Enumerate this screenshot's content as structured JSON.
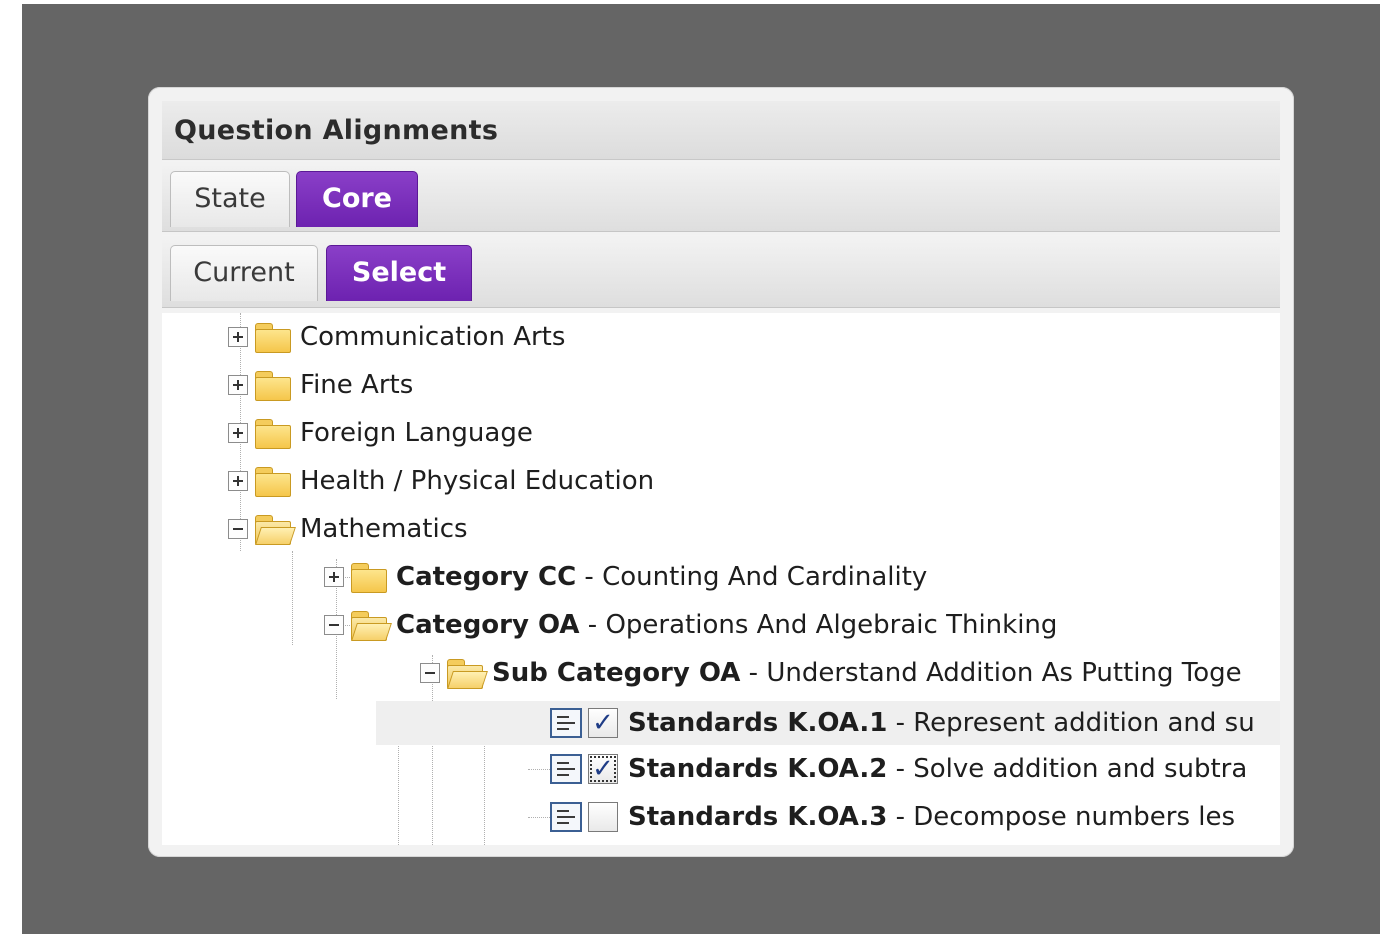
{
  "panel": {
    "title": "Question Alignments"
  },
  "tabs_primary": [
    {
      "label": "State",
      "active": false
    },
    {
      "label": "Core",
      "active": true
    }
  ],
  "tabs_secondary": [
    {
      "label": "Current",
      "active": false
    },
    {
      "label": "Select",
      "active": true
    }
  ],
  "tree": {
    "subjects": [
      {
        "label": "Communication Arts",
        "expanded": false
      },
      {
        "label": "Fine Arts",
        "expanded": false
      },
      {
        "label": "Foreign Language",
        "expanded": false
      },
      {
        "label": "Health / Physical Education",
        "expanded": false
      },
      {
        "label": "Mathematics",
        "expanded": true
      }
    ],
    "categories": [
      {
        "code": "Category CC",
        "separator": " - ",
        "name": "Counting And Cardinality",
        "expanded": false
      },
      {
        "code": "Category OA",
        "separator": " - ",
        "name": "Operations And Algebraic Thinking",
        "expanded": true
      }
    ],
    "subcategory": {
      "code": "Sub Category OA",
      "separator": " - ",
      "name": "Understand Addition As Putting Toge",
      "expanded": true
    },
    "standards": [
      {
        "code": "Standards K.OA.1",
        "separator": " - ",
        "name": "Represent addition and su",
        "checked": true
      },
      {
        "code": "Standards K.OA.2",
        "separator": " - ",
        "name": "Solve addition and subtra",
        "checked": true
      },
      {
        "code": "Standards K.OA.3",
        "separator": " - ",
        "name": "Decompose numbers les",
        "checked": false
      }
    ],
    "icons": {
      "collapsed": "plus-expander-icon",
      "expanded": "minus-expander-icon",
      "folder": "folder-icon",
      "standard": "standard-list-icon"
    },
    "check_glyph": "✓"
  },
  "colors": {
    "active_tab": "#7a2fbf",
    "backdrop": "#656565",
    "folder": "#f5c64a",
    "check": "#1f3c86"
  }
}
